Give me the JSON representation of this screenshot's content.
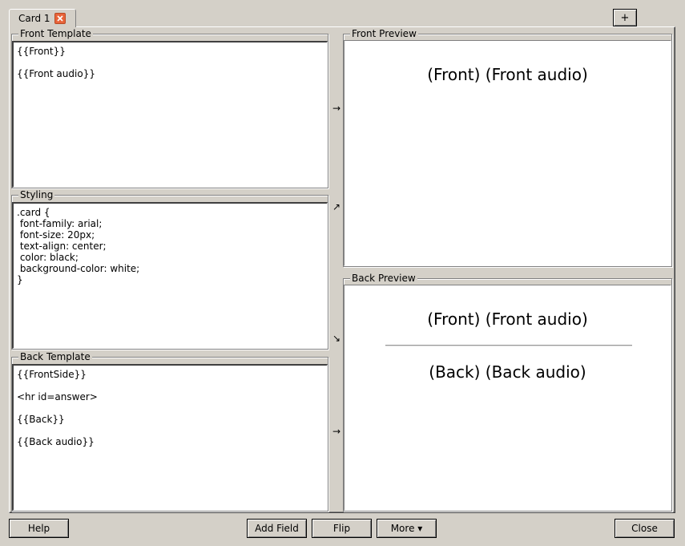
{
  "tabs": [
    {
      "label": "Card 1"
    }
  ],
  "add_card_label": "+",
  "front_template": {
    "title": "Front Template",
    "content": "{{Front}}\n\n{{Front audio}}"
  },
  "styling": {
    "title": "Styling",
    "content": ".card {\n font-family: arial;\n font-size: 20px;\n text-align: center;\n color: black;\n background-color: white;\n}"
  },
  "back_template": {
    "title": "Back Template",
    "content": "{{FrontSide}}\n\n<hr id=answer>\n\n{{Back}}\n\n{{Back audio}}"
  },
  "arrows": {
    "front_to_preview": "→",
    "styling_up": "↗",
    "styling_down": "↘",
    "back_to_preview": "→"
  },
  "front_preview": {
    "title": "Front Preview",
    "text": "(Front) (Front audio)"
  },
  "back_preview": {
    "title": "Back Preview",
    "front_text": "(Front) (Front audio)",
    "back_text": "(Back) (Back audio)"
  },
  "buttons": {
    "help": "Help",
    "add_field": "Add Field",
    "flip": "Flip",
    "more": "More ▾",
    "close": "Close"
  },
  "icons": {
    "tab_close": "close-icon"
  },
  "colors": {
    "window_bg": "#d4d0c8",
    "tab_close_bg": "#e8643a"
  }
}
